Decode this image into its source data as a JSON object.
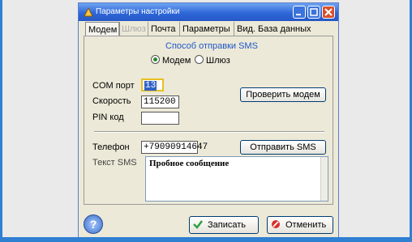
{
  "window": {
    "title": "Параметры настройки"
  },
  "tabs": [
    {
      "label": "Модем",
      "state": "active"
    },
    {
      "label": "Шлюз",
      "state": "disabled"
    },
    {
      "label": "Почта",
      "state": "normal"
    },
    {
      "label": "Параметры",
      "state": "normal"
    },
    {
      "label": "Вид. База данных",
      "state": "normal"
    }
  ],
  "sms_method": {
    "heading": "Способ отправки SMS",
    "options": [
      "Модем",
      "Шлюз"
    ],
    "selected": "Модем"
  },
  "modem": {
    "com_label": "COM порт",
    "com_value": "13",
    "speed_label": "Скорость",
    "speed_value": "115200",
    "pin_label": "PIN код",
    "pin_value": "",
    "check_button": "Проверить модем"
  },
  "sms": {
    "phone_label": "Телефон",
    "phone_value": "+79090914647",
    "send_button": "Отправить SMS",
    "text_label": "Текст SMS",
    "text_value": "Пробное сообщение"
  },
  "footer": {
    "save_button": "Записать",
    "cancel_button": "Отменить"
  },
  "colors": {
    "accent": "#2458c5",
    "desktop": "#2f7fd2",
    "focus": "#e8c020"
  }
}
